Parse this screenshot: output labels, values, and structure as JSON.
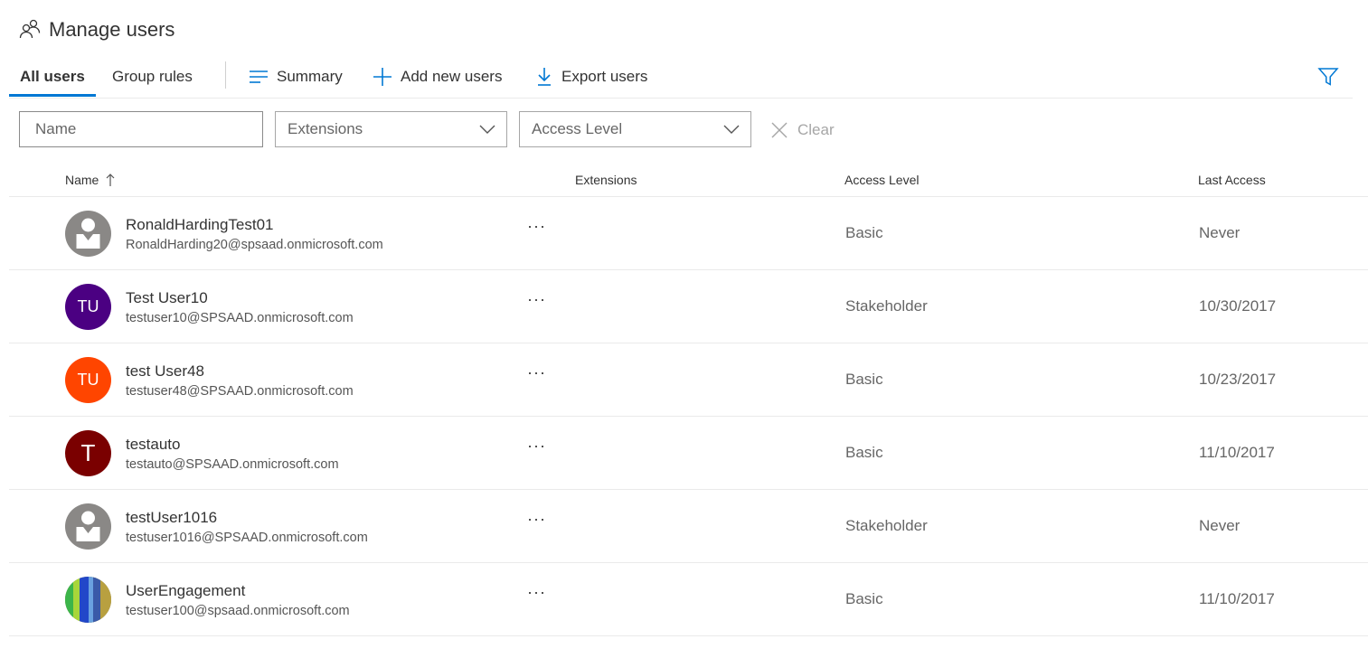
{
  "page": {
    "title": "Manage users",
    "title_icon": "people-icon"
  },
  "pivots": [
    {
      "label": "All users",
      "selected": true
    },
    {
      "label": "Group rules",
      "selected": false
    }
  ],
  "commands": [
    {
      "label": "Summary",
      "icon": "summary-lines-icon"
    },
    {
      "label": "Add new users",
      "icon": "plus-icon"
    },
    {
      "label": "Export users",
      "icon": "download-icon"
    }
  ],
  "filters": {
    "name_placeholder": "Name",
    "extensions_value": "Extensions",
    "access_level_value": "Access Level",
    "clear_label": "Clear"
  },
  "columns": {
    "name": "Name",
    "name_sort_icon": "sort-up-arrow-icon",
    "extensions": "Extensions",
    "access_level": "Access Level",
    "last_access": "Last Access"
  },
  "more_label": "···",
  "users": [
    {
      "name": "RonaldHardingTest01",
      "email": "RonaldHarding20@spsaad.onmicrosoft.com",
      "avatar_type": "placeholder",
      "avatar_color": "#8a8886",
      "initials": "",
      "access": "Basic",
      "last_access": "Never"
    },
    {
      "name": "Test User10",
      "email": "testuser10@SPSAAD.onmicrosoft.com",
      "avatar_type": "initials",
      "avatar_color": "#4b0082",
      "initials": "TU",
      "access": "Stakeholder",
      "last_access": "10/30/2017"
    },
    {
      "name": "test User48",
      "email": "testuser48@SPSAAD.onmicrosoft.com",
      "avatar_type": "initials",
      "avatar_color": "#ff4500",
      "initials": "TU",
      "access": "Basic",
      "last_access": "10/23/2017"
    },
    {
      "name": "testauto",
      "email": "testauto@SPSAAD.onmicrosoft.com",
      "avatar_type": "initials",
      "avatar_color": "#7a0000",
      "initials": "T",
      "access": "Basic",
      "last_access": "11/10/2017"
    },
    {
      "name": "testUser1016",
      "email": "testuser1016@SPSAAD.onmicrosoft.com",
      "avatar_type": "placeholder",
      "avatar_color": "#8a8886",
      "initials": "",
      "access": "Stakeholder",
      "last_access": "Never"
    },
    {
      "name": "UserEngagement",
      "email": "testuser100@spsaad.onmicrosoft.com",
      "avatar_type": "image",
      "avatar_color": "#3a5aa8",
      "initials": "",
      "access": "Basic",
      "last_access": "11/10/2017"
    }
  ],
  "colors": {
    "accent": "#0078d4",
    "border": "#eaeaea",
    "muted_text": "#666666"
  }
}
